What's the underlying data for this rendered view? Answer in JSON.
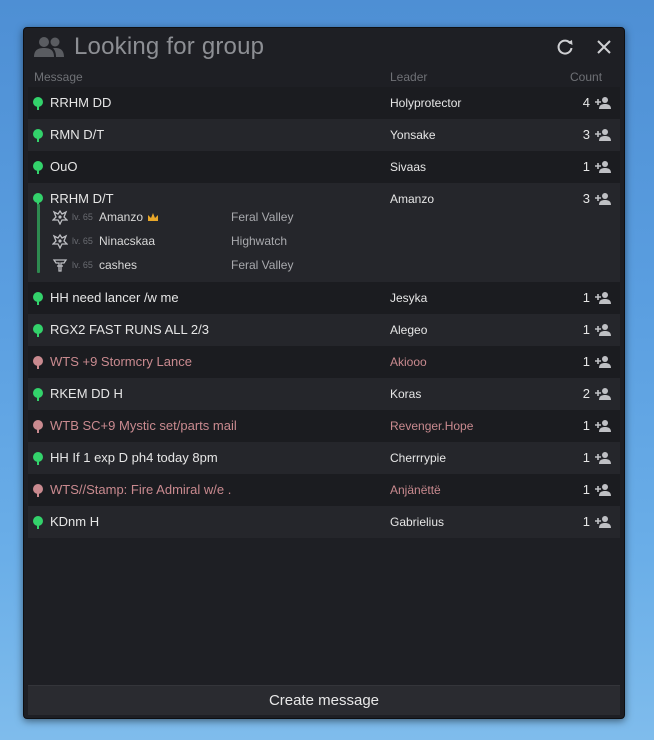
{
  "window": {
    "title": "Looking for group"
  },
  "columns": {
    "message": "Message",
    "leader": "Leader",
    "count": "Count"
  },
  "rows": [
    {
      "message": "RRHM DD",
      "leader": "Holyprotector",
      "count": "4",
      "status": "green"
    },
    {
      "message": "RMN D/T",
      "leader": "Yonsake",
      "count": "3",
      "status": "green"
    },
    {
      "message": "OuO",
      "leader": "Sivaas",
      "count": "1",
      "status": "green"
    },
    {
      "message": "RRHM D/T",
      "leader": "Amanzo",
      "count": "3",
      "status": "green",
      "expanded": true,
      "members": [
        {
          "level": "lv. 65",
          "name": "Amanzo",
          "server": "Feral Valley",
          "class_icon": "mystic-class-icon",
          "leader": true
        },
        {
          "level": "lv. 65",
          "name": "Ninacskaa",
          "server": "Highwatch",
          "class_icon": "mystic-class-icon",
          "leader": false
        },
        {
          "level": "lv. 65",
          "name": "cashes",
          "server": "Feral Valley",
          "class_icon": "brawler-class-icon",
          "leader": false
        }
      ]
    },
    {
      "message": "HH need lancer /w me",
      "leader": "Jesyka",
      "count": "1",
      "status": "green"
    },
    {
      "message": "RGX2 FAST RUNS ALL 2/3",
      "leader": "Alegeo",
      "count": "1",
      "status": "green"
    },
    {
      "message": "WTS +9 Stormcry Lance",
      "leader": "Akiooo",
      "count": "1",
      "status": "pink"
    },
    {
      "message": "RKEM DD H",
      "leader": "Koras",
      "count": "2",
      "status": "green"
    },
    {
      "message": "WTB SC+9 Mystic set/parts mail",
      "leader": "Revenger.Hope",
      "count": "1",
      "status": "pink"
    },
    {
      "message": "HH If 1 exp D ph4 today 8pm",
      "leader": "Cherrrypie",
      "count": "1",
      "status": "green"
    },
    {
      "message": "WTS//Stamp: Fire Admiral w/e .",
      "leader": "Anjänëttë",
      "count": "1",
      "status": "pink"
    },
    {
      "message": "KDnm H",
      "leader": "Gabrielius",
      "count": "1",
      "status": "green"
    }
  ],
  "footer": {
    "create_label": "Create message"
  },
  "colors": {
    "green": "#33d26b",
    "pink": "#c98a8f",
    "background": "#1e1f24"
  }
}
